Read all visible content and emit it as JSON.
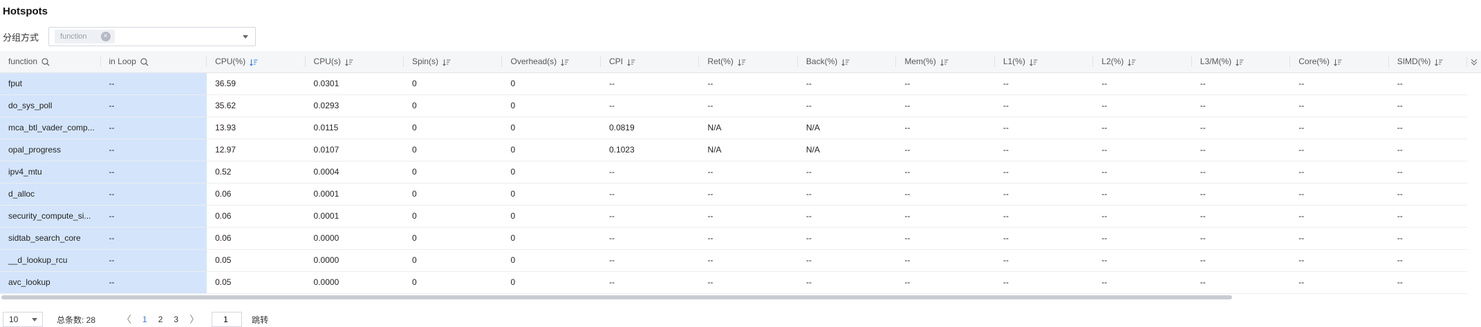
{
  "title": "Hotspots",
  "group_by": {
    "label": "分组方式",
    "tag": "function",
    "close_glyph": "×"
  },
  "columns": [
    {
      "label": "function",
      "icon": "search-icon"
    },
    {
      "label": "in Loop",
      "icon": "search-icon"
    },
    {
      "label": "CPU(%)",
      "icon": "sort-desc-icon",
      "active": true
    },
    {
      "label": "CPU(s)",
      "icon": "sort-icon"
    },
    {
      "label": "Spin(s)",
      "icon": "sort-icon"
    },
    {
      "label": "Overhead(s)",
      "icon": "sort-icon"
    },
    {
      "label": "CPI",
      "icon": "sort-icon"
    },
    {
      "label": "Ret(%)",
      "icon": "sort-icon"
    },
    {
      "label": "Back(%)",
      "icon": "sort-icon"
    },
    {
      "label": "Mem(%)",
      "icon": "sort-icon"
    },
    {
      "label": "L1(%)",
      "icon": "sort-icon"
    },
    {
      "label": "L2(%)",
      "icon": "sort-icon"
    },
    {
      "label": "L3/M(%)",
      "icon": "sort-icon"
    },
    {
      "label": "Core(%)",
      "icon": "sort-icon"
    },
    {
      "label": "SIMD(%)",
      "icon": "sort-icon"
    }
  ],
  "rows": [
    [
      "fput",
      "--",
      "36.59",
      "0.0301",
      "0",
      "0",
      "--",
      "--",
      "--",
      "--",
      "--",
      "--",
      "--",
      "--",
      "--"
    ],
    [
      "do_sys_poll",
      "--",
      "35.62",
      "0.0293",
      "0",
      "0",
      "--",
      "--",
      "--",
      "--",
      "--",
      "--",
      "--",
      "--",
      "--"
    ],
    [
      "mca_btl_vader_comp...",
      "--",
      "13.93",
      "0.0115",
      "0",
      "0",
      "0.0819",
      "N/A",
      "N/A",
      "--",
      "--",
      "--",
      "--",
      "--",
      "--"
    ],
    [
      "opal_progress",
      "--",
      "12.97",
      "0.0107",
      "0",
      "0",
      "0.1023",
      "N/A",
      "N/A",
      "--",
      "--",
      "--",
      "--",
      "--",
      "--"
    ],
    [
      "ipv4_mtu",
      "--",
      "0.52",
      "0.0004",
      "0",
      "0",
      "--",
      "--",
      "--",
      "--",
      "--",
      "--",
      "--",
      "--",
      "--"
    ],
    [
      "d_alloc",
      "--",
      "0.06",
      "0.0001",
      "0",
      "0",
      "--",
      "--",
      "--",
      "--",
      "--",
      "--",
      "--",
      "--",
      "--"
    ],
    [
      "security_compute_si...",
      "--",
      "0.06",
      "0.0001",
      "0",
      "0",
      "--",
      "--",
      "--",
      "--",
      "--",
      "--",
      "--",
      "--",
      "--"
    ],
    [
      "sidtab_search_core",
      "--",
      "0.06",
      "0.0000",
      "0",
      "0",
      "--",
      "--",
      "--",
      "--",
      "--",
      "--",
      "--",
      "--",
      "--"
    ],
    [
      "__d_lookup_rcu",
      "--",
      "0.05",
      "0.0000",
      "0",
      "0",
      "--",
      "--",
      "--",
      "--",
      "--",
      "--",
      "--",
      "--",
      "--"
    ],
    [
      "avc_lookup",
      "--",
      "0.05",
      "0.0000",
      "0",
      "0",
      "--",
      "--",
      "--",
      "--",
      "--",
      "--",
      "--",
      "--",
      "--"
    ]
  ],
  "pagination": {
    "page_size": "10",
    "total_label": "总条数: 28",
    "pages": [
      "1",
      "2",
      "3"
    ],
    "current_page": "1",
    "jump_value": "1",
    "jump_label": "跳转",
    "prev_glyph": "〈",
    "next_glyph": "〉"
  },
  "colors": {
    "highlight": "#d4e5fb",
    "accent": "#2f7be8",
    "header_bg": "#f5f6f8"
  }
}
